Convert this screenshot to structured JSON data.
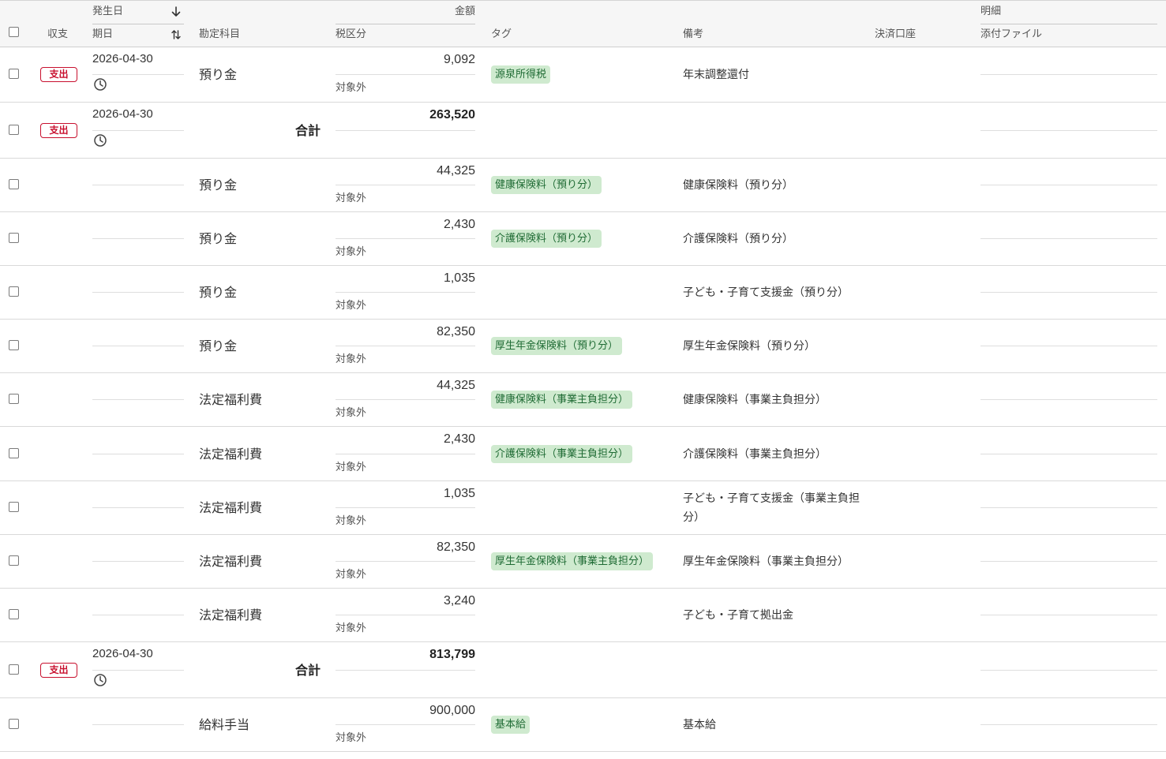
{
  "header": {
    "select_all_label": "",
    "kind": "収支",
    "occurrence_date": "発生日",
    "due_date": "期日",
    "account": "勘定科目",
    "amount": "金額",
    "tax_category": "税区分",
    "tag": "タグ",
    "memo": "備考",
    "payment_account": "決済口座",
    "detail": "明細",
    "attachment": "添付ファイル"
  },
  "rows": [
    {
      "type": "expense",
      "badge": "支出",
      "date": "2026-04-30",
      "account": "預り金",
      "amount": "9,092",
      "tax": "対象外",
      "tag": "源泉所得税",
      "memo": "年末調整還付"
    },
    {
      "type": "total",
      "badge": "支出",
      "date": "2026-04-30",
      "total_label": "合計",
      "amount": "263,520"
    },
    {
      "type": "item",
      "account": "預り金",
      "amount": "44,325",
      "tax": "対象外",
      "tag": "健康保険料（預り分）",
      "memo": "健康保険料（預り分）"
    },
    {
      "type": "item",
      "account": "預り金",
      "amount": "2,430",
      "tax": "対象外",
      "tag": "介護保険料（預り分）",
      "memo": "介護保険料（預り分）"
    },
    {
      "type": "item",
      "account": "預り金",
      "amount": "1,035",
      "tax": "対象外",
      "tag": "",
      "memo": "子ども・子育て支援金（預り分）"
    },
    {
      "type": "item",
      "account": "預り金",
      "amount": "82,350",
      "tax": "対象外",
      "tag": "厚生年金保険料（預り分）",
      "memo": "厚生年金保険料（預り分）"
    },
    {
      "type": "item",
      "account": "法定福利費",
      "amount": "44,325",
      "tax": "対象外",
      "tag": "健康保険料（事業主負担分）",
      "memo": "健康保険料（事業主負担分）"
    },
    {
      "type": "item",
      "account": "法定福利費",
      "amount": "2,430",
      "tax": "対象外",
      "tag": "介護保険料（事業主負担分）",
      "memo": "介護保険料（事業主負担分）"
    },
    {
      "type": "item",
      "account": "法定福利費",
      "amount": "1,035",
      "tax": "対象外",
      "tag": "",
      "memo": "子ども・子育て支援金（事業主負担分）"
    },
    {
      "type": "item",
      "account": "法定福利費",
      "amount": "82,350",
      "tax": "対象外",
      "tag": "厚生年金保険料（事業主負担分）",
      "memo": "厚生年金保険料（事業主負担分）"
    },
    {
      "type": "item",
      "account": "法定福利費",
      "amount": "3,240",
      "tax": "対象外",
      "tag": "",
      "memo": "子ども・子育て拠出金"
    },
    {
      "type": "total",
      "badge": "支出",
      "date": "2026-04-30",
      "total_label": "合計",
      "amount": "813,799"
    },
    {
      "type": "item",
      "account": "給料手当",
      "amount": "900,000",
      "tax": "対象外",
      "tag": "基本給",
      "memo": "基本給"
    }
  ],
  "colors": {
    "expense_badge": "#c8102e",
    "tag_bg": "#cfeacf",
    "tag_text": "#1f6b34",
    "header_bg": "#f6f6f6"
  },
  "icons": {
    "sort_desc": "arrow-down-icon",
    "sort_toggle": "sort-arrows-icon",
    "due_date": "clock-icon"
  }
}
